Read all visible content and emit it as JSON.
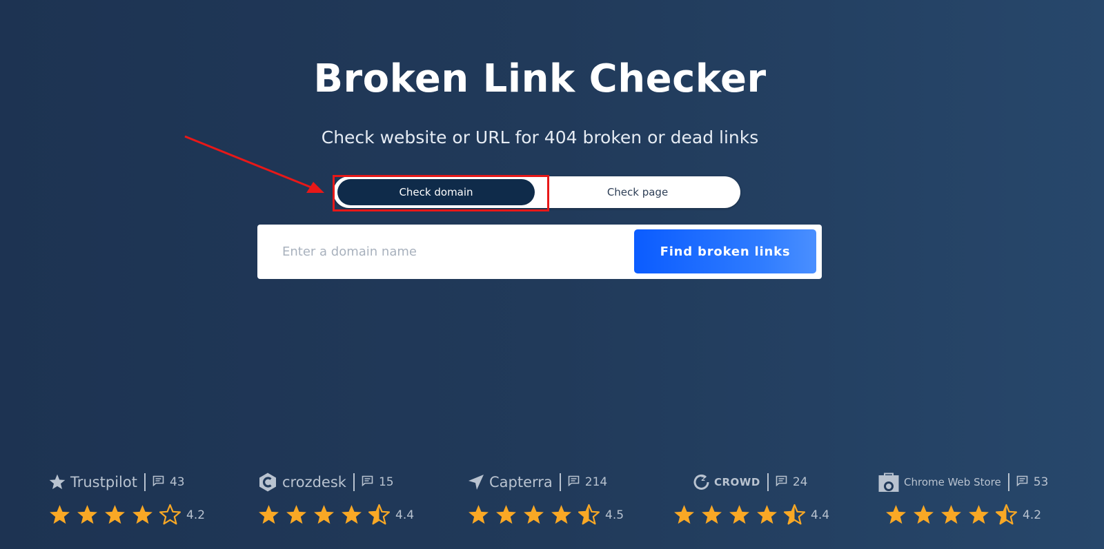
{
  "header": {
    "title": "Broken Link Checker",
    "subtitle": "Check website or URL for 404 broken or dead links"
  },
  "mode_toggle": {
    "options": [
      {
        "label": "Check domain",
        "selected": true
      },
      {
        "label": "Check page",
        "selected": false
      }
    ]
  },
  "search": {
    "placeholder": "Enter a domain name",
    "value": "",
    "button_label": "Find broken links"
  },
  "annotation": {
    "highlight_color": "#e81818"
  },
  "ratings": [
    {
      "platform": "Trustpilot",
      "icon": "star-logo-icon",
      "reviews": "43",
      "score": "4.2",
      "stars": [
        "full",
        "full",
        "full",
        "full",
        "empty"
      ]
    },
    {
      "platform": "crozdesk",
      "icon": "crozdesk-logo-icon",
      "reviews": "15",
      "score": "4.4",
      "stars": [
        "full",
        "full",
        "full",
        "full",
        "half"
      ]
    },
    {
      "platform": "Capterra",
      "icon": "capterra-logo-icon",
      "reviews": "214",
      "score": "4.5",
      "stars": [
        "full",
        "full",
        "full",
        "full",
        "half"
      ]
    },
    {
      "platform": "CROWD",
      "icon": "g2-logo-icon",
      "reviews": "24",
      "score": "4.4",
      "stars": [
        "full",
        "full",
        "full",
        "full",
        "half"
      ]
    },
    {
      "platform": "Chrome Web Store",
      "icon": "chrome-store-logo-icon",
      "reviews": "53",
      "score": "4.2",
      "stars": [
        "full",
        "full",
        "full",
        "full",
        "half"
      ]
    }
  ],
  "colors": {
    "star": "#f9a825",
    "primary_button": "#0b5cff",
    "toggle_active": "#0f2b4a"
  }
}
